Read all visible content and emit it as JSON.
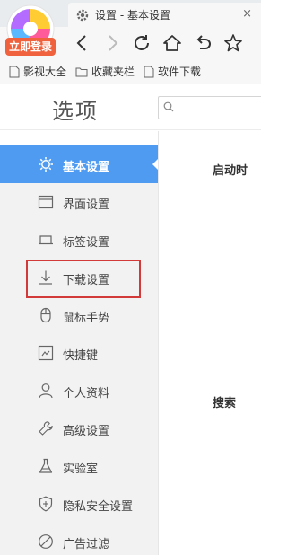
{
  "browser": {
    "tab_title": "设置 - 基本设置",
    "tab_close": "×",
    "login_label": "立即登录",
    "bookmarks": [
      {
        "label": "影视大全",
        "icon": "page-icon"
      },
      {
        "label": "收藏夹栏",
        "icon": "folder-icon"
      },
      {
        "label": "软件下载",
        "icon": "page-icon"
      }
    ],
    "nav_icons": [
      "back-icon",
      "forward-icon",
      "reload-icon",
      "home-icon",
      "undo-icon",
      "star-icon"
    ]
  },
  "options": {
    "title": "选项",
    "search_placeholder": ""
  },
  "sidebar": {
    "items": [
      {
        "label": "基本设置",
        "icon": "gear-icon",
        "active": true
      },
      {
        "label": "界面设置",
        "icon": "window-icon",
        "active": false
      },
      {
        "label": "标签设置",
        "icon": "tab-icon",
        "active": false
      },
      {
        "label": "下载设置",
        "icon": "download-icon",
        "active": false,
        "highlighted": true
      },
      {
        "label": "鼠标手势",
        "icon": "mouse-icon",
        "active": false
      },
      {
        "label": "快捷键",
        "icon": "keyboard-icon",
        "active": false
      },
      {
        "label": "个人资料",
        "icon": "person-icon",
        "active": false
      },
      {
        "label": "高级设置",
        "icon": "wrench-icon",
        "active": false
      },
      {
        "label": "实验室",
        "icon": "flask-icon",
        "active": false
      },
      {
        "label": "隐私安全设置",
        "icon": "shield-icon",
        "active": false
      },
      {
        "label": "广告过滤",
        "icon": "block-icon",
        "active": false
      }
    ]
  },
  "content": {
    "sections": [
      {
        "label": "启动时"
      },
      {
        "label": "搜索"
      }
    ]
  },
  "colors": {
    "accent": "#4f9bf1",
    "highlight_border": "#d23a3a",
    "login_badge": "#f0623d"
  }
}
